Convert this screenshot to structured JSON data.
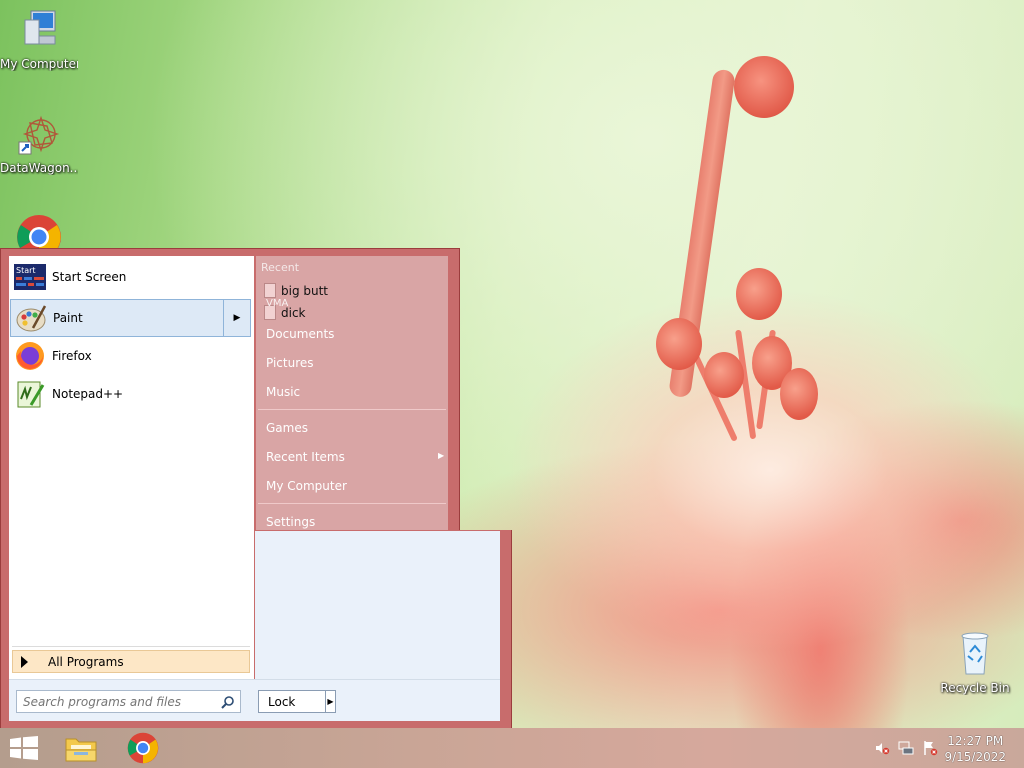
{
  "desktop": {
    "icons": [
      {
        "label": "My Computer",
        "icon": "computer-icon"
      },
      {
        "label": "DataWagon...",
        "icon": "datawagon-icon"
      },
      {
        "label": "",
        "icon": "chrome-icon"
      },
      {
        "label": "Recycle Bin",
        "icon": "recycle-bin-icon"
      }
    ]
  },
  "start_menu": {
    "programs": [
      {
        "label": "Start Screen",
        "icon": "start-screen-icon"
      },
      {
        "label": "Paint",
        "icon": "paint-icon",
        "has_submenu": true
      },
      {
        "label": "Firefox",
        "icon": "firefox-icon"
      },
      {
        "label": "Notepad++",
        "icon": "notepadpp-icon"
      }
    ],
    "all_programs": "All Programs",
    "search_placeholder": "Search programs and files",
    "lock_label": "Lock",
    "right_pane": {
      "recent_header": "Recent",
      "recent_items": [
        "big butt",
        "dick"
      ],
      "overlay_text": "VMA",
      "group1": [
        "Documents",
        "Pictures",
        "Music"
      ],
      "group2": [
        "Games",
        "Recent Items",
        "My Computer"
      ],
      "group3": [
        "Settings"
      ]
    }
  },
  "taskbar": {
    "pinned": [
      "start-button",
      "file-explorer-icon",
      "chrome-icon"
    ],
    "time": "12:27 PM",
    "date": "9/15/2022"
  },
  "colors": {
    "menu_frame": "#c86c6c",
    "right_pane": "#d9a5a5",
    "selected": "#dde9f6",
    "all_programs_bg": "#fde7c6"
  }
}
